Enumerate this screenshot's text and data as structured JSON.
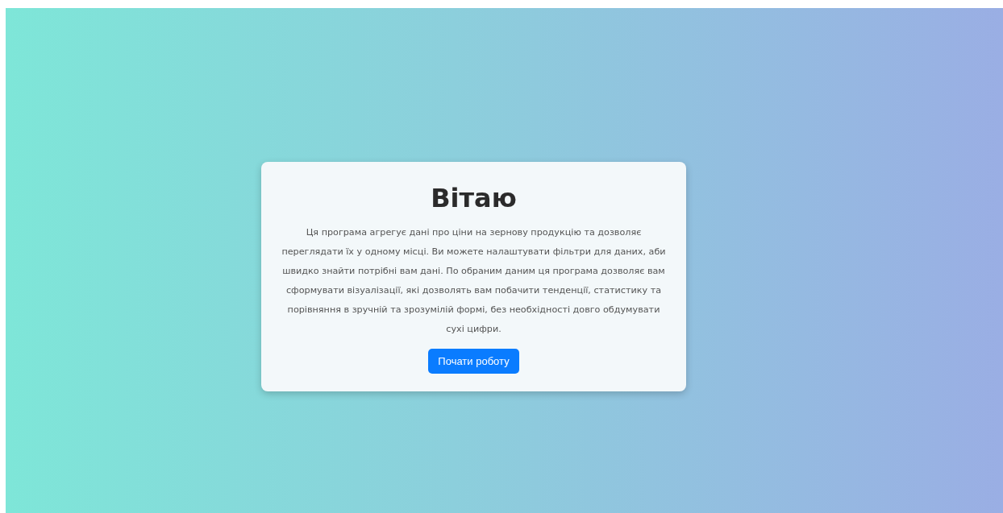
{
  "welcome_card": {
    "title": "Вітаю",
    "description": "Ця програма агрегує дані про ціни на зернову продукцію та дозволяє переглядати їх у одному місці. Ви можете налаштувати фільтри для даних, аби швидко знайти потрібні вам дані. По обраним даним ця програма дозволяє вам сформувати візуалізації, які дозволять вам побачити тенденції, статистику та порівняння в зручній та зрозумілій формі, без необхідності довго обдумувати сухі цифри.",
    "button": "Почати роботу"
  }
}
